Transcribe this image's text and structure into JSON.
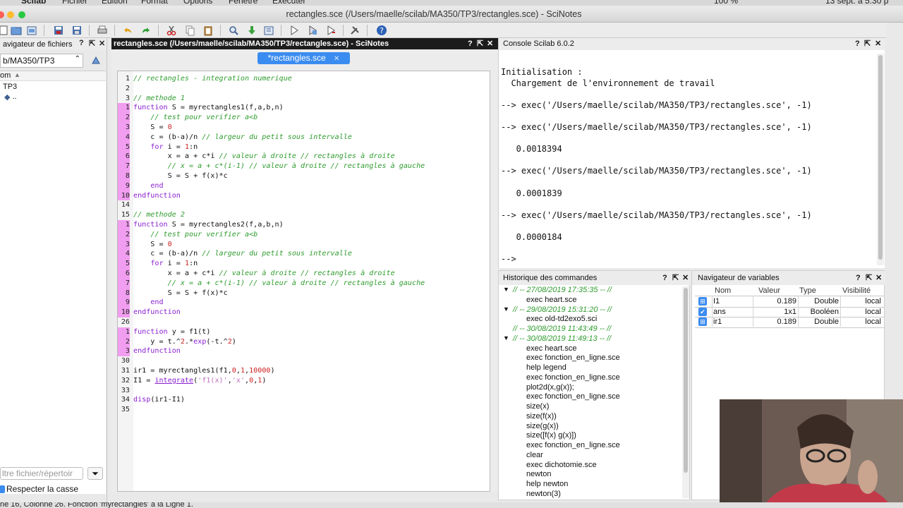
{
  "menubar": {
    "app": "Scilab",
    "menus": [
      "Fichier",
      "Edition",
      "Format",
      "Options",
      "Fenêtre",
      "Exécuter"
    ],
    "right": "100 %",
    "date": "13 sept. à 5:30 p"
  },
  "window": {
    "title": "rectangles.sce (/Users/maelle/scilab/MA350/TP3/rectangles.sce) - SciNotes"
  },
  "file_browser": {
    "title": "avigateur de fichiers",
    "path": "b/MA350/TP3",
    "column": "om",
    "tree": [
      "TP3",
      ".."
    ],
    "filter_placeholder": "ltre fichier/répertoir",
    "case_label": "Respecter la casse"
  },
  "editor": {
    "header": "rectangles.sce (/Users/maelle/scilab/MA350/TP3/rectangles.sce) - SciNotes",
    "tab": "*rectangles.sce",
    "tab_close": "✕"
  },
  "code": [
    {
      "n": "1",
      "pk": false,
      "t": "// rectangles - integration numerique"
    },
    {
      "n": "2",
      "pk": false,
      "t": ""
    },
    {
      "n": "3",
      "pk": false,
      "t": "// methode 1"
    },
    {
      "n": "1",
      "pk": true,
      "t": "function S = myrectangles1(f,a,b,n)"
    },
    {
      "n": "2",
      "pk": true,
      "t": "    // test pour verifier a<b"
    },
    {
      "n": "3",
      "pk": true,
      "t": "    S = 0"
    },
    {
      "n": "4",
      "pk": true,
      "t": "    c = (b-a)/n // largeur du petit sous intervalle"
    },
    {
      "n": "5",
      "pk": true,
      "t": "    for i = 1:n"
    },
    {
      "n": "6",
      "pk": true,
      "t": "        x = a + c*i // valeur à droite // rectangles à droite"
    },
    {
      "n": "7",
      "pk": true,
      "t": "        // x = a + c*(i-1) // valeur à droite // rectangles à gauche"
    },
    {
      "n": "8",
      "pk": true,
      "t": "        S = S + f(x)*c"
    },
    {
      "n": "9",
      "pk": true,
      "t": "    end"
    },
    {
      "n": "10",
      "pk": true,
      "t": "endfunction"
    },
    {
      "n": "14",
      "pk": false,
      "t": ""
    },
    {
      "n": "15",
      "pk": false,
      "t": "// methode 2"
    },
    {
      "n": "1",
      "pk": true,
      "t": "function S = myrectangles2(f,a,b,n)"
    },
    {
      "n": "2",
      "pk": true,
      "t": "    // test pour verifier a<b"
    },
    {
      "n": "3",
      "pk": true,
      "t": "    S = 0"
    },
    {
      "n": "4",
      "pk": true,
      "t": "    c = (b-a)/n // largeur du petit sous intervalle"
    },
    {
      "n": "5",
      "pk": true,
      "t": "    for i = 1:n"
    },
    {
      "n": "6",
      "pk": true,
      "t": "        x = a + c*i // valeur à droite // rectangles à droite"
    },
    {
      "n": "7",
      "pk": true,
      "t": "        // x = a + c*(i-1) // valeur à droite // rectangles à gauche"
    },
    {
      "n": "8",
      "pk": true,
      "t": "        S = S + f(x)*c"
    },
    {
      "n": "9",
      "pk": true,
      "t": "    end"
    },
    {
      "n": "10",
      "pk": true,
      "t": "endfunction"
    },
    {
      "n": "26",
      "pk": false,
      "t": ""
    },
    {
      "n": "1",
      "pk": true,
      "t": "function y = f1(t)"
    },
    {
      "n": "2",
      "pk": true,
      "t": "    y = t.^2.*exp(-t.^2)"
    },
    {
      "n": "3",
      "pk": true,
      "t": "endfunction"
    },
    {
      "n": "30",
      "pk": false,
      "t": ""
    },
    {
      "n": "31",
      "pk": false,
      "t": "ir1 = myrectangles1(f1,0,1,10000)"
    },
    {
      "n": "32",
      "pk": false,
      "t": "I1 = integrate('f1(x)','x',0,1)"
    },
    {
      "n": "33",
      "pk": false,
      "t": ""
    },
    {
      "n": "34",
      "pk": false,
      "t": "disp(ir1-I1)"
    },
    {
      "n": "35",
      "pk": false,
      "t": ""
    }
  ],
  "console": {
    "title": "Console Scilab 6.0.2",
    "lines": [
      "Initialisation :",
      "  Chargement de l'environnement de travail",
      "",
      "--> exec('/Users/maelle/scilab/MA350/TP3/rectangles.sce', -1)",
      "",
      "--> exec('/Users/maelle/scilab/MA350/TP3/rectangles.sce', -1)",
      "",
      "   0.0018394",
      "",
      "--> exec('/Users/maelle/scilab/MA350/TP3/rectangles.sce', -1)",
      "",
      "   0.0001839",
      "",
      "--> exec('/Users/maelle/scilab/MA350/TP3/rectangles.sce', -1)",
      "",
      "   0.0000184",
      "",
      "-->"
    ]
  },
  "history": {
    "title": "Historique des commandes",
    "rows": [
      {
        "type": "session",
        "text": "// -- 27/08/2019 17:35:35 -- //",
        "arrow": true
      },
      {
        "type": "cmd",
        "text": "exec heart.sce"
      },
      {
        "type": "session",
        "text": "// -- 29/08/2019 15:31:20 -- //",
        "arrow": true
      },
      {
        "type": "cmd",
        "text": "exec old-td2exo5.sci"
      },
      {
        "type": "session",
        "text": "// -- 30/08/2019 11:43:49 -- //",
        "arrow": false
      },
      {
        "type": "session",
        "text": "// -- 30/08/2019 11:49:13 -- //",
        "arrow": true
      },
      {
        "type": "cmd",
        "text": "exec heart.sce"
      },
      {
        "type": "cmd",
        "text": "exec fonction_en_ligne.sce"
      },
      {
        "type": "cmd",
        "text": "help legend"
      },
      {
        "type": "cmd",
        "text": "exec fonction_en_ligne.sce"
      },
      {
        "type": "cmd",
        "text": "plot2d(x,g(x));"
      },
      {
        "type": "cmd",
        "text": "exec fonction_en_ligne.sce"
      },
      {
        "type": "cmd",
        "text": "size(x)"
      },
      {
        "type": "cmd",
        "text": "size(f(x))"
      },
      {
        "type": "cmd",
        "text": "size(g(x))"
      },
      {
        "type": "cmd",
        "text": "size([f(x) g(x)])"
      },
      {
        "type": "cmd",
        "text": "exec fonction_en_ligne.sce"
      },
      {
        "type": "cmd",
        "text": "clear"
      },
      {
        "type": "cmd",
        "text": "exec dichotomie.sce"
      },
      {
        "type": "cmd",
        "text": "newton"
      },
      {
        "type": "cmd",
        "text": "help newton"
      },
      {
        "type": "cmd",
        "text": "newton(3)"
      }
    ]
  },
  "variables": {
    "title": "Navigateur de variables",
    "headers": [
      "Nom",
      "Valeur",
      "Type",
      "Visibilité"
    ],
    "rows": [
      {
        "name": "I1",
        "value": "0.189",
        "type": "Double",
        "vis": "local",
        "icon": "matrix-icon"
      },
      {
        "name": "ans",
        "value": "1x1",
        "type": "Booléen",
        "vis": "local",
        "icon": "boolean-icon"
      },
      {
        "name": "ir1",
        "value": "0.189",
        "type": "Double",
        "vis": "local",
        "icon": "matrix-icon"
      }
    ]
  },
  "status": "ne 16, Colonne 26. Fonction 'myrectangles' à la Ligne 1."
}
